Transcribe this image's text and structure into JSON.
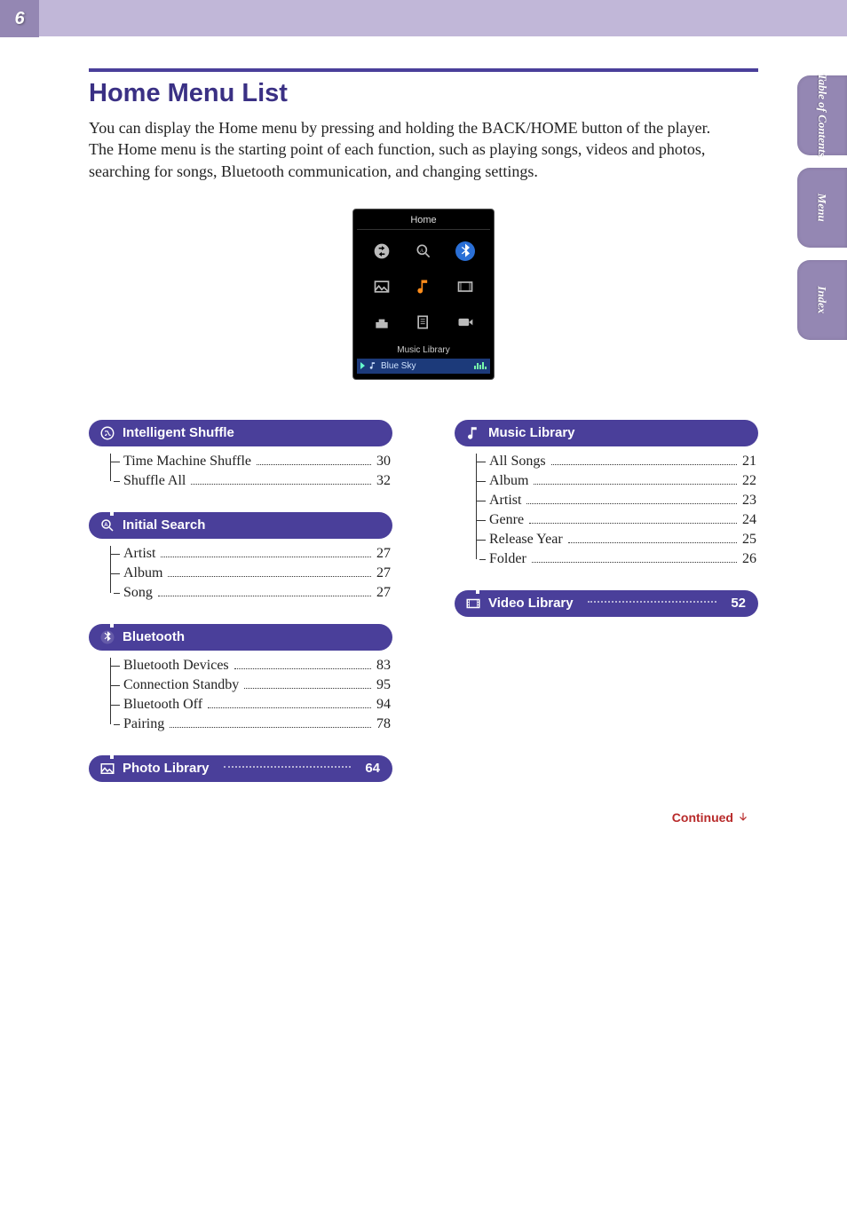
{
  "page_number": "6",
  "side_tabs": [
    "Table of\nContents",
    "Menu",
    "Index"
  ],
  "title": "Home Menu List",
  "intro": "You can display the Home menu by pressing and holding the BACK/HOME button of the player. The Home menu is the starting point of each function, such as playing songs, videos and photos, searching for songs, Bluetooth communication, and changing settings.",
  "device": {
    "header": "Home",
    "selected_label": "Music Library",
    "now_playing": "Blue Sky"
  },
  "left": [
    {
      "icon": "shuffle-icon",
      "title": "Intelligent Shuffle",
      "items": [
        {
          "label": "Time Machine Shuffle",
          "page": "30"
        },
        {
          "label": "Shuffle All",
          "page": "32"
        }
      ]
    },
    {
      "icon": "search-icon",
      "title": "Initial Search",
      "items": [
        {
          "label": "Artist",
          "page": "27"
        },
        {
          "label": "Album",
          "page": "27"
        },
        {
          "label": "Song",
          "page": "27"
        }
      ]
    },
    {
      "icon": "bluetooth-icon",
      "title": "Bluetooth",
      "items": [
        {
          "label": "Bluetooth Devices",
          "page": "83"
        },
        {
          "label": "Connection Standby",
          "page": "95"
        },
        {
          "label": "Bluetooth Off",
          "page": "94"
        },
        {
          "label": "Pairing",
          "page": "78"
        }
      ]
    },
    {
      "icon": "photo-icon",
      "title": "Photo Library",
      "page": "64"
    }
  ],
  "right": [
    {
      "icon": "music-icon",
      "title": "Music Library",
      "items": [
        {
          "label": "All Songs",
          "page": "21"
        },
        {
          "label": "Album",
          "page": "22"
        },
        {
          "label": "Artist",
          "page": "23"
        },
        {
          "label": "Genre",
          "page": "24"
        },
        {
          "label": "Release Year",
          "page": "25"
        },
        {
          "label": "Folder",
          "page": "26"
        }
      ]
    },
    {
      "icon": "video-icon",
      "title": "Video Library",
      "page": "52"
    }
  ],
  "continued": "Continued"
}
